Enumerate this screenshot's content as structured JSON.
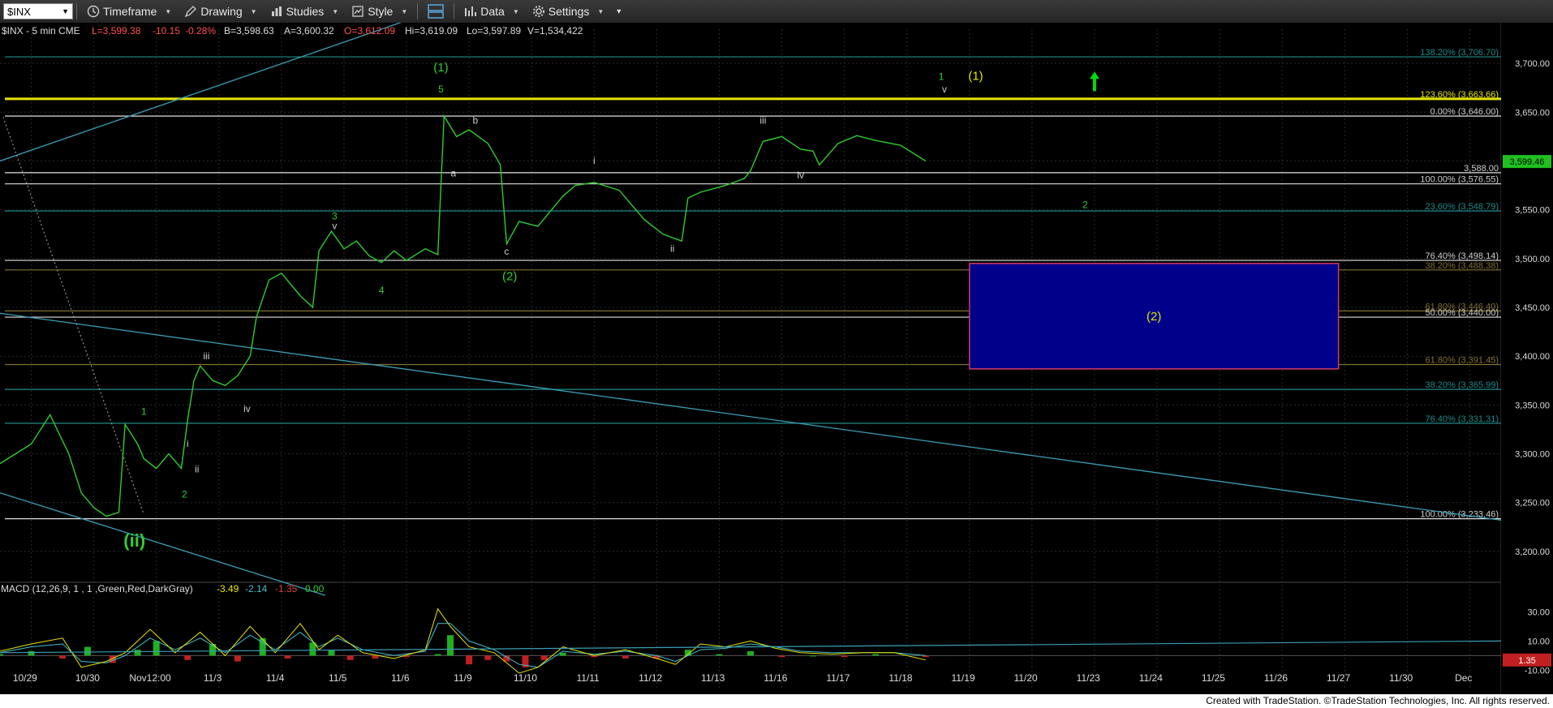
{
  "toolbar": {
    "symbol": "$INX",
    "timeframe": "Timeframe",
    "drawing": "Drawing",
    "studies": "Studies",
    "style": "Style",
    "data": "Data",
    "settings": "Settings"
  },
  "header": {
    "symbol_info": "$INX - 5 min  CME",
    "last": "L=3,599.38",
    "change": "-10.15",
    "change_pct": "-0.28%",
    "bid": "B=3,598.63",
    "ask": "A=3,600.32",
    "open": "O=3,612.09",
    "high": "Hi=3,619.09",
    "low": "Lo=3,597.89",
    "volume": "V=1,534,422"
  },
  "chart_data": {
    "type": "line",
    "price_axis": {
      "ticks": [
        3700,
        3650,
        3600,
        3550,
        3500,
        3450,
        3400,
        3350,
        3300,
        3250,
        3200
      ],
      "tick_labels": [
        "3,700.00",
        "3,650.00",
        "3,600.00",
        "3,550.00",
        "3,500.00",
        "3,450.00",
        "3,400.00",
        "3,350.00",
        "3,300.00",
        "3,250.00",
        "3,200.00"
      ],
      "current_price": "3,599.46",
      "ylim": [
        3175,
        3735
      ]
    },
    "date_axis": {
      "labels": [
        "10/29",
        "10/30",
        "Nov12:00",
        "11/3",
        "11/4",
        "11/5",
        "11/6",
        "11/9",
        "11/10",
        "11/11",
        "11/12",
        "11/13",
        "11/16",
        "11/17",
        "11/18",
        "11/19",
        "11/20",
        "11/23",
        "11/24",
        "11/25",
        "11/26",
        "11/27",
        "11/30",
        "Dec"
      ],
      "xlim": [
        0,
        24
      ]
    },
    "price_series": {
      "name": "$INX",
      "color": "#2ecc2e",
      "x": [
        0,
        0.5,
        0.8,
        1.1,
        1.3,
        1.5,
        1.7,
        1.9,
        2.0,
        2.2,
        2.3,
        2.5,
        2.7,
        2.9,
        3.0,
        3.1,
        3.2,
        3.4,
        3.6,
        3.8,
        4.0,
        4.1,
        4.3,
        4.5,
        4.8,
        5.0,
        5.1,
        5.3,
        5.5,
        5.7,
        5.9,
        6.1,
        6.3,
        6.5,
        6.8,
        7.0,
        7.1,
        7.3,
        7.5,
        7.8,
        8.0,
        8.1,
        8.3,
        8.6,
        9.0,
        9.2,
        9.5,
        9.9,
        10.3,
        10.6,
        10.9,
        11.0,
        11.2,
        11.6,
        11.9,
        12.0,
        12.2,
        12.5,
        12.8,
        13.0,
        13.1,
        13.4,
        13.7,
        14.0,
        14.4,
        14.8
      ],
      "y": [
        3290,
        3310,
        3340,
        3300,
        3260,
        3245,
        3236,
        3240,
        3330,
        3310,
        3295,
        3285,
        3300,
        3285,
        3335,
        3375,
        3390,
        3375,
        3370,
        3380,
        3400,
        3440,
        3478,
        3485,
        3462,
        3450,
        3508,
        3528,
        3510,
        3518,
        3503,
        3496,
        3508,
        3498,
        3510,
        3504,
        3646,
        3625,
        3632,
        3618,
        3596,
        3515,
        3538,
        3533,
        3564,
        3575,
        3578,
        3570,
        3540,
        3525,
        3518,
        3562,
        3568,
        3575,
        3582,
        3590,
        3620,
        3625,
        3612,
        3610,
        3596,
        3618,
        3626,
        3621,
        3616,
        3600
      ]
    },
    "horizontal_levels": [
      {
        "label": "138.20% (3,706.70)",
        "value": 3706.7,
        "color": "#1f8a8a"
      },
      {
        "label": "123.60% (3,663.66)",
        "value": 3663.66,
        "color": "#e6e600"
      },
      {
        "label": "0.00% (3,646.00)",
        "value": 3646.0,
        "color": "#e0e0e0"
      },
      {
        "label": "3,588.00",
        "value": 3588.0,
        "color": "#ffffff"
      },
      {
        "label": "100.00% (3,576.55)",
        "value": 3576.55,
        "color": "#e0e0e0"
      },
      {
        "label": "23.60% (3,548.79)",
        "value": 3548.79,
        "color": "#1f8a8a"
      },
      {
        "label": "76.40% (3,498.14)",
        "value": 3498.14,
        "color": "#e0e0e0"
      },
      {
        "label": "38.20% (3,488.38)",
        "value": 3488.38,
        "color": "#807030"
      },
      {
        "label": "61.80% (3,446.40)",
        "value": 3446.4,
        "color": "#807030"
      },
      {
        "label": "50.00% (3,440.00)",
        "value": 3440.0,
        "color": "#e0e0e0"
      },
      {
        "label": "61.80% (3,391.45)",
        "value": 3391.45,
        "color": "#807030"
      },
      {
        "label": "38.20% (3,365.99)",
        "value": 3365.99,
        "color": "#1f8a8a"
      },
      {
        "label": "76.40% (3,331.31)",
        "value": 3331.31,
        "color": "#1f8a8a"
      },
      {
        "label": "100.00% (3,233.46)",
        "value": 3233.46,
        "color": "#e0e0e0"
      }
    ],
    "target_box": {
      "label": "(2)",
      "y_top": 3495,
      "y_bottom": 3387,
      "x_start": 15.5,
      "x_end": 21.4
    },
    "wave_labels": [
      {
        "text": "(1)",
        "x": 7.05,
        "y": 3692,
        "color": "#33cc33"
      },
      {
        "text": "5",
        "x": 7.05,
        "y": 3670,
        "color": "#33cc33"
      },
      {
        "text": "b",
        "x": 7.6,
        "y": 3638,
        "color": "#cccccc"
      },
      {
        "text": "a",
        "x": 7.25,
        "y": 3584,
        "color": "#cccccc"
      },
      {
        "text": "c",
        "x": 8.1,
        "y": 3504,
        "color": "#cccccc"
      },
      {
        "text": "(2)",
        "x": 8.15,
        "y": 3478,
        "color": "#33cc33"
      },
      {
        "text": "i",
        "x": 9.5,
        "y": 3597,
        "color": "#cccccc"
      },
      {
        "text": "ii",
        "x": 10.75,
        "y": 3507,
        "color": "#cccccc"
      },
      {
        "text": "iii",
        "x": 12.2,
        "y": 3638,
        "color": "#cccccc"
      },
      {
        "text": "iv",
        "x": 12.8,
        "y": 3582,
        "color": "#cccccc"
      },
      {
        "text": "3",
        "x": 5.35,
        "y": 3540,
        "color": "#33cc33"
      },
      {
        "text": "v",
        "x": 5.35,
        "y": 3530,
        "color": "#cccccc"
      },
      {
        "text": "4",
        "x": 6.1,
        "y": 3464,
        "color": "#33cc33"
      },
      {
        "text": "iii",
        "x": 3.3,
        "y": 3397,
        "color": "#cccccc"
      },
      {
        "text": "iv",
        "x": 3.95,
        "y": 3343,
        "color": "#cccccc"
      },
      {
        "text": "1",
        "x": 2.3,
        "y": 3340,
        "color": "#33cc33"
      },
      {
        "text": "i",
        "x": 3.0,
        "y": 3307,
        "color": "#cccccc"
      },
      {
        "text": "ii",
        "x": 3.15,
        "y": 3281,
        "color": "#cccccc"
      },
      {
        "text": "2",
        "x": 2.95,
        "y": 3255,
        "color": "#33cc33"
      },
      {
        "text": "(ii)",
        "x": 2.15,
        "y": 3205,
        "color": "#33cc33"
      },
      {
        "text": "1",
        "x": 15.05,
        "y": 3683,
        "color": "#33cc33"
      },
      {
        "text": "v",
        "x": 15.1,
        "y": 3670,
        "color": "#cccccc"
      },
      {
        "text": "(1)",
        "x": 15.6,
        "y": 3683,
        "color": "#e6e600"
      },
      {
        "text": "2",
        "x": 17.35,
        "y": 3552,
        "color": "#33cc33"
      }
    ],
    "trend_lines": [
      {
        "x": [
          0,
          7.0
        ],
        "y": [
          3600,
          3755
        ],
        "color": "#3a9fb5"
      },
      {
        "x": [
          0,
          24
        ],
        "y": [
          3444,
          3232
        ],
        "color": "#3a9fb5"
      },
      {
        "x": [
          0,
          5.2
        ],
        "y": [
          3260,
          3155
        ],
        "color": "#3a9fb5"
      }
    ],
    "dotted_line": {
      "x": [
        0.05,
        2.3
      ],
      "y": [
        3645,
        3238
      ],
      "color": "#aaaaaa"
    },
    "arrow_up": {
      "x": 17.5,
      "y": 3680,
      "color": "#00dd00"
    },
    "macd": {
      "label": "MACD (12,26,9, 1 , 1 ,Green,Red,DarkGray)",
      "values": [
        "-3.49",
        "-2.14",
        "-1.35",
        "0.00"
      ],
      "value_colors": [
        "#e6e600",
        "#40c0d0",
        "#e04040",
        "#33cc33"
      ],
      "ticks": [
        30,
        10,
        -10
      ],
      "tick_labels": [
        "30.00",
        "10.00",
        "-10.00"
      ],
      "current_value": "1.35",
      "ylim": [
        -22,
        38
      ],
      "hist_x": [
        0,
        0.5,
        1,
        1.4,
        1.8,
        2.2,
        2.5,
        3.0,
        3.4,
        3.8,
        4.2,
        4.6,
        5.0,
        5.3,
        5.6,
        6.0,
        6.5,
        7.0,
        7.2,
        7.5,
        7.8,
        8.1,
        8.4,
        8.7,
        9.0,
        9.5,
        10.0,
        10.5,
        11.0,
        11.5,
        12.0,
        12.5,
        13.0,
        13.5,
        14.0,
        14.8
      ],
      "hist_y": [
        1,
        3,
        -2,
        6,
        -5,
        4,
        10,
        -3,
        8,
        -4,
        12,
        -2,
        9,
        4,
        -3,
        -2,
        -1,
        1,
        14,
        -6,
        -3,
        -4,
        -8,
        -3,
        2,
        -1,
        -2,
        -2,
        4,
        1,
        3,
        -1,
        0,
        -1,
        1,
        -1
      ],
      "line_x": [
        0,
        0.5,
        1.0,
        1.3,
        1.7,
        2.0,
        2.4,
        2.8,
        3.2,
        3.6,
        4.0,
        4.4,
        4.8,
        5.1,
        5.4,
        5.8,
        6.3,
        6.8,
        7.0,
        7.2,
        7.5,
        7.9,
        8.3,
        8.6,
        9.0,
        9.5,
        10.0,
        10.5,
        10.8,
        11.2,
        11.6,
        12.0,
        12.4,
        12.8,
        13.3,
        13.8,
        14.3,
        14.8
      ],
      "line_y": [
        3,
        8,
        12,
        -8,
        -4,
        2,
        18,
        2,
        16,
        0,
        20,
        2,
        22,
        4,
        14,
        2,
        -2,
        4,
        32,
        20,
        6,
        2,
        -12,
        -8,
        6,
        0,
        4,
        -2,
        -6,
        8,
        6,
        10,
        5,
        2,
        1,
        2,
        2,
        -3
      ],
      "signal_y": [
        2,
        6,
        8,
        -4,
        -5,
        0,
        12,
        4,
        12,
        2,
        14,
        4,
        16,
        6,
        12,
        4,
        0,
        3,
        22,
        22,
        10,
        4,
        -6,
        -8,
        3,
        1,
        3,
        0,
        -4,
        4,
        5,
        8,
        6,
        3,
        2,
        2,
        2,
        0
      ],
      "zero_line": {
        "x": [
          0,
          24
        ],
        "y": [
          2,
          10
        ],
        "color": "#3a9fb5"
      }
    }
  },
  "footer": "Created with TradeStation. ©TradeStation Technologies, Inc. All rights reserved."
}
